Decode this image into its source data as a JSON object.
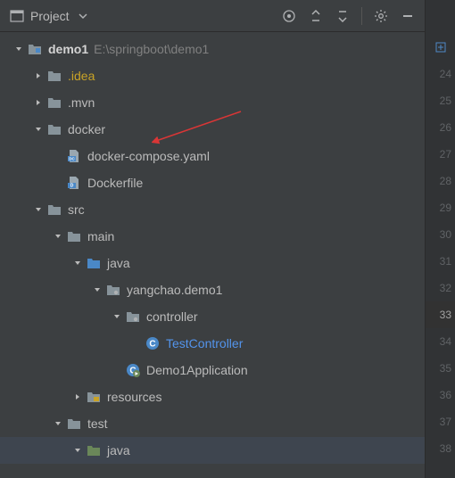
{
  "header": {
    "title": "Project"
  },
  "tree": {
    "root": {
      "name": "demo1",
      "path": "E:\\springboot\\demo1"
    },
    "idea": ".idea",
    "mvn": ".mvn",
    "docker": "docker",
    "docker_compose": "docker-compose.yaml",
    "dockerfile": "Dockerfile",
    "src": "src",
    "main": "main",
    "java": "java",
    "pkg": "yangchao.demo1",
    "controller": "controller",
    "test_controller": "TestController",
    "demo1_app": "Demo1Application",
    "resources": "resources",
    "test": "test",
    "java2": "java"
  },
  "gutter": [
    "24",
    "25",
    "26",
    "27",
    "28",
    "29",
    "30",
    "31",
    "32",
    "33",
    "34",
    "35",
    "36",
    "37",
    "38"
  ],
  "gutter_highlight_index": 9
}
